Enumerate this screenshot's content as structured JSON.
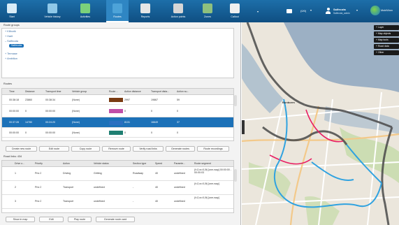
{
  "nav": [
    {
      "label": "Start",
      "icon": "home-icon"
    },
    {
      "label": "Vehicle history",
      "icon": "vehicle-history-icon"
    },
    {
      "label": "Activities",
      "icon": "activities-icon"
    },
    {
      "label": "Routes",
      "icon": "routes-icon"
    },
    {
      "label": "Reports",
      "icon": "reports-icon"
    },
    {
      "label": "Action points",
      "icon": "action-points-icon"
    },
    {
      "label": "Zones",
      "icon": "zones-icon"
    },
    {
      "label": "Callout",
      "icon": "callout-icon"
    }
  ],
  "header": {
    "count": "(0/0)",
    "user_name": "Salfecota",
    "user_sub": "Salfecota_admin",
    "brand": "MobiWorx"
  },
  "route_groups": {
    "title": "Route groups",
    "items": [
      "Kilborik",
      "Harit",
      "Salfecota",
      "Termase",
      "Ambition"
    ],
    "selected_child": "Salfecota"
  },
  "routes": {
    "title": "Routes",
    "columns": [
      "Time",
      "Distance",
      "Transport time",
      "Vehicle group",
      "Route ...",
      "Action distance",
      "Transport dista...",
      "Action su..."
    ],
    "rows": [
      {
        "time": "00:38:18",
        "distance": "23860",
        "transport": "00:38:34",
        "group": "(None)",
        "color": "#7a3b12",
        "action_distance": "2997",
        "transport_distance": "19867",
        "action_sum": "59"
      },
      {
        "time": "00:00:00",
        "distance": "0",
        "transport": "00:00:00",
        "group": "(None)",
        "color": "#c04fa8",
        "action_distance": "0",
        "transport_distance": "0",
        "action_sum": "0"
      },
      {
        "time": "00:37:28",
        "distance": "14780",
        "transport": "00:24:20",
        "group": "(None)",
        "color": "#2a6fc0",
        "action_distance": "8131",
        "transport_distance": "16649",
        "action_sum": "37"
      },
      {
        "time": "00:00:00",
        "distance": "0",
        "transport": "00:00:00",
        "group": "(None)",
        "color": "#1f7f72",
        "action_distance": "0",
        "transport_distance": "0",
        "action_sum": "0"
      }
    ]
  },
  "route_buttons": [
    "Create new route",
    "Edit route",
    "Copy route",
    "Remove route",
    "Verify road links",
    "Generate routes",
    "Route recordings"
  ],
  "road_links": {
    "title": "Road links: 434",
    "columns": [
      "Drive o...",
      "Priority",
      "Action",
      "Vehicle status",
      "Section type",
      "Speed",
      "Paramte...",
      "Route segment"
    ],
    "rows": [
      {
        "drive": "1",
        "priority": "Prio 2",
        "action": "Driving",
        "status": "Gritting",
        "section": "Roadway",
        "speed": "40",
        "param": "undefined",
        "segment": "(f=2,w=0,0t) [one-way] 00:00:00 - 00:00:03"
      },
      {
        "drive": "2",
        "priority": "Prio 2",
        "action": "Transport",
        "status": "undefined",
        "section": "-",
        "speed": "40",
        "param": "undefined",
        "segment": "(f=2,w=0,0t) [one-way]"
      },
      {
        "drive": "3",
        "priority": "Prio 2",
        "action": "Transport",
        "status": "undefined",
        "section": "-",
        "speed": "40",
        "param": "undefined",
        "segment": "(f=2,w=0,0t) [one-way]"
      }
    ]
  },
  "bottom_buttons": [
    "Show in map",
    "Edit",
    "Play route",
    "Generate route card"
  ],
  "map": {
    "place": "Bunborm",
    "controls": [
      "Layer",
      "Map objects",
      "Map tools",
      "Road data",
      "Other"
    ]
  }
}
